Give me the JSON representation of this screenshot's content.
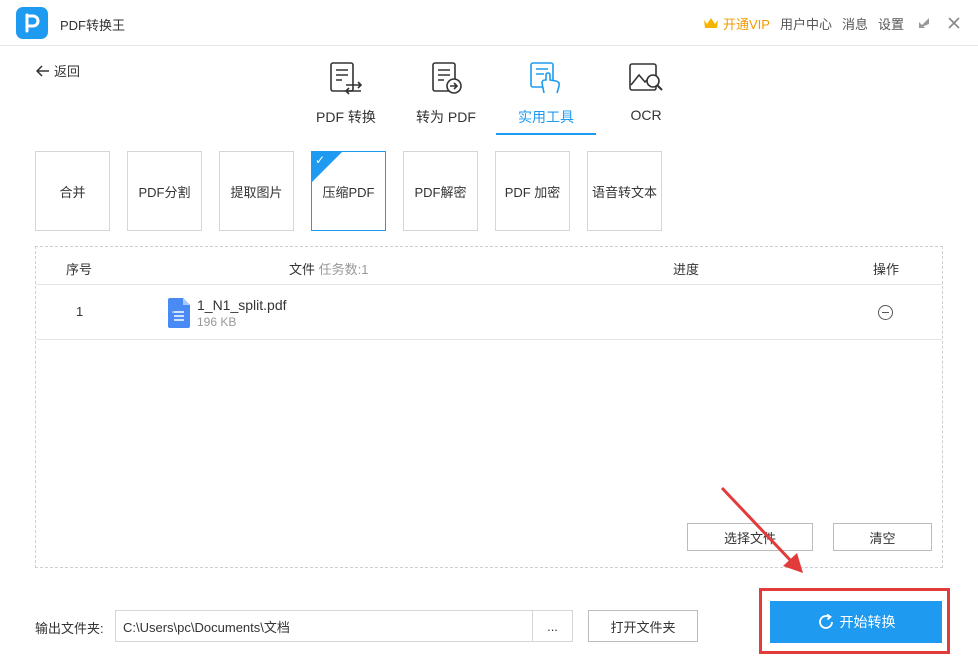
{
  "app": {
    "title": "PDF转换王"
  },
  "titlebar": {
    "vip": "开通VIP",
    "user_center": "用户中心",
    "messages": "消息",
    "settings": "设置"
  },
  "back": {
    "label": "返回"
  },
  "tabs": [
    {
      "label": "PDF 转换",
      "icon": "pdf-convert-icon"
    },
    {
      "label": "转为 PDF",
      "icon": "to-pdf-icon"
    },
    {
      "label": "实用工具",
      "icon": "tools-icon",
      "active": true
    },
    {
      "label": "OCR",
      "icon": "ocr-image-icon"
    }
  ],
  "tools": [
    {
      "label": "合并"
    },
    {
      "label": "PDF分割"
    },
    {
      "label": "提取图片"
    },
    {
      "label": "压缩PDF",
      "active": true
    },
    {
      "label": "PDF解密"
    },
    {
      "label": "PDF 加密"
    },
    {
      "label": "语音转文本"
    }
  ],
  "table": {
    "col_index": "序号",
    "col_file": "文件",
    "task_count_label": "任务数:1",
    "col_progress": "进度",
    "col_action": "操作",
    "rows": [
      {
        "index": "1",
        "name": "1_N1_split.pdf",
        "size": "196 KB"
      }
    ]
  },
  "buttons": {
    "select_file": "选择文件",
    "clear": "清空",
    "open_folder": "打开文件夹",
    "start": "开始转换",
    "browse": "..."
  },
  "output": {
    "label": "输出文件夹:",
    "path": "C:\\Users\\pc\\Documents\\文档"
  },
  "colors": {
    "accent": "#1e9bf0",
    "highlight": "#e23b3b",
    "vip": "#f29b00"
  }
}
